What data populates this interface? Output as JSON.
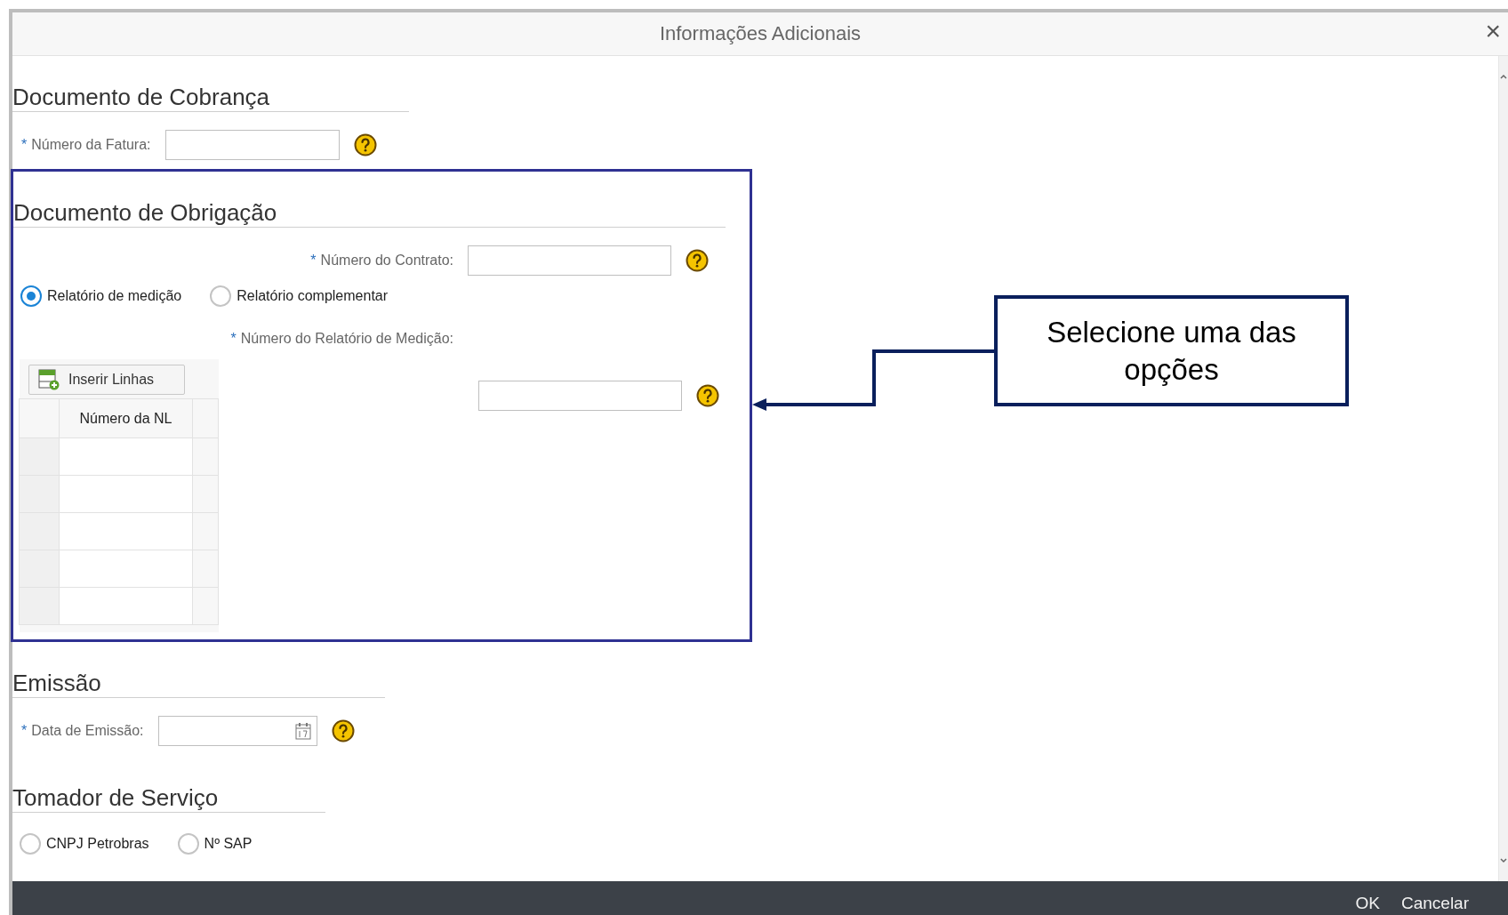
{
  "dialog": {
    "title": "Informações Adicionais",
    "close": "×"
  },
  "cobranca": {
    "heading": "Documento de Cobrança",
    "field": {
      "required_mark": "*",
      "label": "Número da Fatura:"
    }
  },
  "obrigacao": {
    "heading": "Documento de Obrigação",
    "contract_field": {
      "required_mark": "*",
      "label": "Número do Contrato:"
    },
    "report_type": [
      {
        "label": "Relatório de medição",
        "selected": true
      },
      {
        "label": "Relatório complementar",
        "selected": false
      }
    ],
    "report_field": {
      "required_mark": "*",
      "label": "Número do Relatório de Medição:"
    },
    "table": {
      "toolbar_button": "Inserir Linhas",
      "columns": [
        "Número da NL"
      ]
    }
  },
  "emissao": {
    "heading": "Emissão",
    "field": {
      "required_mark": "*",
      "label": "Data de Emissão:"
    }
  },
  "tomador": {
    "heading": "Tomador de Serviço",
    "options": [
      {
        "label": "CNPJ Petrobras",
        "selected": false
      },
      {
        "label": "Nº SAP",
        "selected": false
      }
    ]
  },
  "annotation": {
    "text": "Selecione uma das opções"
  },
  "footer": {
    "buttons": [
      "OK",
      "Cancelar"
    ]
  }
}
